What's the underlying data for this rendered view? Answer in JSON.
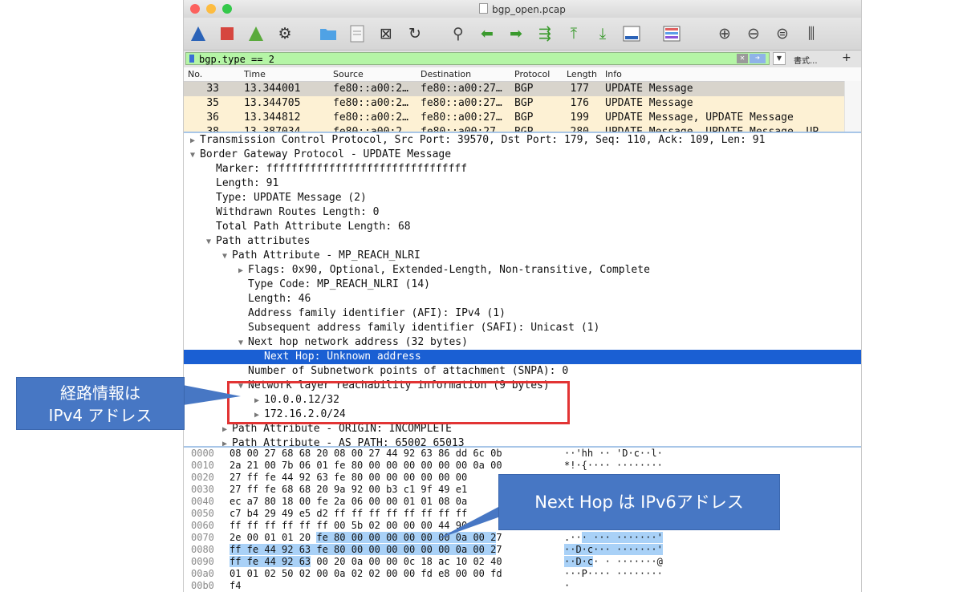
{
  "window": {
    "title": "bgp_open.pcap"
  },
  "filter": {
    "value": "bgp.type == 2",
    "format_label": "書式...",
    "add_label": "+"
  },
  "packet_list": {
    "columns": [
      "No.",
      "Time",
      "Source",
      "Destination",
      "Protocol",
      "Length",
      "Info"
    ],
    "rows": [
      {
        "no": "33",
        "time": "13.344001",
        "src": "fe80::a00:2…",
        "dst": "fe80::a00:27…",
        "proto": "BGP",
        "len": "177",
        "info": "UPDATE Message"
      },
      {
        "no": "35",
        "time": "13.344705",
        "src": "fe80::a00:2…",
        "dst": "fe80::a00:27…",
        "proto": "BGP",
        "len": "176",
        "info": "UPDATE Message"
      },
      {
        "no": "36",
        "time": "13.344812",
        "src": "fe80::a00:2…",
        "dst": "fe80::a00:27…",
        "proto": "BGP",
        "len": "199",
        "info": "UPDATE Message, UPDATE Message"
      },
      {
        "no": "38",
        "time": "13.387034",
        "src": "fe80::a00:2…",
        "dst": "fe80::a00:27…",
        "proto": "BGP",
        "len": "280",
        "info": "UPDATE Message, UPDATE Message, UP"
      }
    ]
  },
  "details": [
    {
      "indent": 0,
      "tri": "▶",
      "text": "Transmission Control Protocol, Src Port: 39570, Dst Port: 179, Seq: 110, Ack: 109, Len: 91"
    },
    {
      "indent": 0,
      "tri": "▼",
      "text": "Border Gateway Protocol - UPDATE Message"
    },
    {
      "indent": 1,
      "tri": "",
      "text": "Marker: ffffffffffffffffffffffffffffffff"
    },
    {
      "indent": 1,
      "tri": "",
      "text": "Length: 91"
    },
    {
      "indent": 1,
      "tri": "",
      "text": "Type: UPDATE Message (2)"
    },
    {
      "indent": 1,
      "tri": "",
      "text": "Withdrawn Routes Length: 0"
    },
    {
      "indent": 1,
      "tri": "",
      "text": "Total Path Attribute Length: 68"
    },
    {
      "indent": 1,
      "tri": "▼",
      "text": "Path attributes"
    },
    {
      "indent": 2,
      "tri": "▼",
      "text": "Path Attribute - MP_REACH_NLRI"
    },
    {
      "indent": 3,
      "tri": "▶",
      "text": "Flags: 0x90, Optional, Extended-Length, Non-transitive, Complete"
    },
    {
      "indent": 3,
      "tri": "",
      "text": "Type Code: MP_REACH_NLRI (14)"
    },
    {
      "indent": 3,
      "tri": "",
      "text": "Length: 46"
    },
    {
      "indent": 3,
      "tri": "",
      "text": "Address family identifier (AFI): IPv4 (1)"
    },
    {
      "indent": 3,
      "tri": "",
      "text": "Subsequent address family identifier (SAFI): Unicast (1)"
    },
    {
      "indent": 3,
      "tri": "▼",
      "text": "Next hop network address (32 bytes)"
    },
    {
      "indent": 4,
      "tri": "",
      "text": "Next Hop: Unknown address"
    },
    {
      "indent": 3,
      "tri": "",
      "text": "Number of Subnetwork points of attachment (SNPA): 0"
    },
    {
      "indent": 3,
      "tri": "▼",
      "text": "Network layer reachability information (9 bytes)"
    },
    {
      "indent": 4,
      "tri": "▶",
      "text": "10.0.0.12/32"
    },
    {
      "indent": 4,
      "tri": "▶",
      "text": "172.16.2.0/24"
    },
    {
      "indent": 2,
      "tri": "▶",
      "text": "Path Attribute - ORIGIN: INCOMPLETE"
    },
    {
      "indent": 2,
      "tri": "▶",
      "text": "Path Attribute - AS_PATH: 65002 65013"
    }
  ],
  "hex": [
    {
      "off": "0000",
      "bytes": "08 00 27 68 68 20 08 00  27 44 92 63 86 dd 6c 0b",
      "ascii": "··'hh ·· 'D·c··l·"
    },
    {
      "off": "0010",
      "bytes": "2a 21 00 7b 06 01 fe 80  00 00 00 00 00 00 0a 00",
      "ascii": "*!·{···· ········"
    },
    {
      "off": "0020",
      "bytes": "27 ff fe 44 92 63 fe 80  00 00 00 00 00 00",
      "ascii": ""
    },
    {
      "off": "0030",
      "bytes": "27 ff fe 68 68 20 9a 92  00 b3 c1 9f 49 e1",
      "ascii": ""
    },
    {
      "off": "0040",
      "bytes": "ec a7 80 18 00 fe 2a 06  00 00 01 01 08 0a",
      "ascii": ""
    },
    {
      "off": "0050",
      "bytes": "c7 b4 29 49 e5 d2 ff ff  ff ff ff ff ff ff",
      "ascii": ""
    },
    {
      "off": "0060",
      "bytes": "ff ff ff ff ff ff 00 5b  02 00 00 00 44 90",
      "ascii": ""
    },
    {
      "off": "0070",
      "bytes": "2e 00 01 01 20 fe 80 00  00 00 00 00 00 0a 00 27",
      "ascii": ".··· ··· ·······'"
    },
    {
      "off": "0080",
      "bytes": "ff fe 44 92 63 fe 80 00  00 00 00 00 00 0a 00 27",
      "ascii": "··D·c··· ·······'"
    },
    {
      "off": "0090",
      "bytes": "ff fe 44 92 63 00 20 0a  00 00 0c 18 ac 10 02 40",
      "ascii": "··D·c· · ·······@"
    },
    {
      "off": "00a0",
      "bytes": "01 01 02 50 02 00 0a 02  02 00 00 fd e8 00 00 fd",
      "ascii": "···P···· ········"
    },
    {
      "off": "00b0",
      "bytes": "f4",
      "ascii": "·"
    }
  ],
  "annotations": {
    "route_info_line1": "経路情報は",
    "route_info_line2": "IPv4 アドレス",
    "next_hop": "Next Hop は IPv6アドレス"
  },
  "colors": {
    "selected": "#1a5fd3",
    "highlight": "#a9d1f7",
    "filter_ok": "#b5f5a6",
    "callout": "#4777c4",
    "redbox": "#e23434"
  }
}
